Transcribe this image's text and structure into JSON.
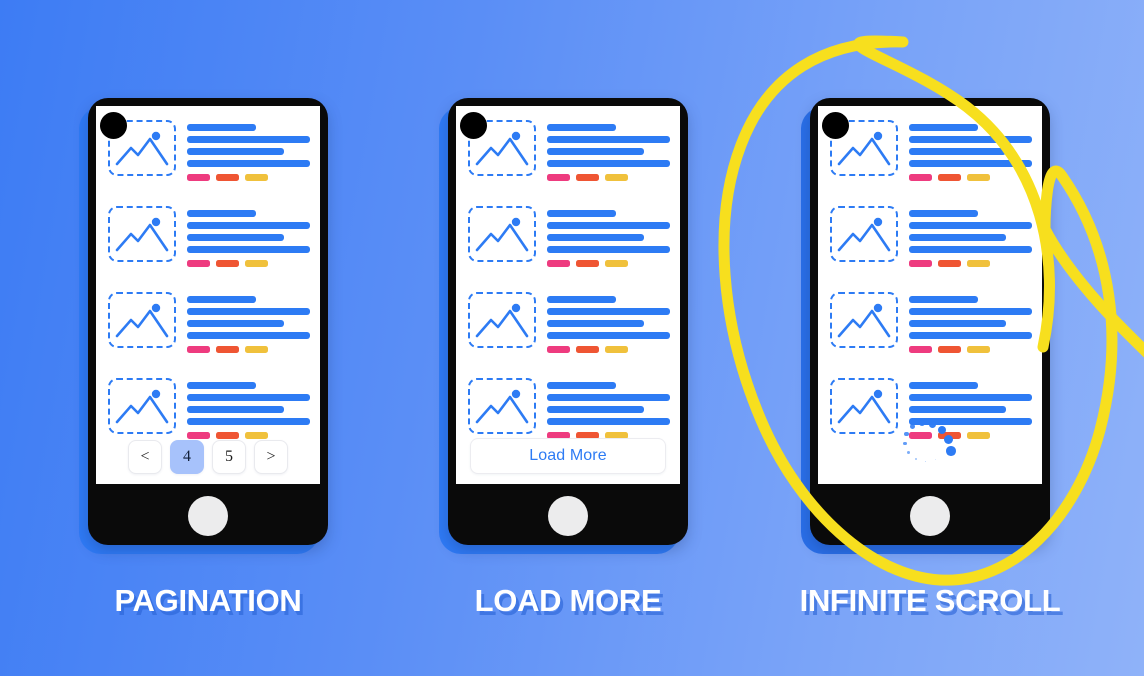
{
  "background": {
    "gradient_from": "#3d7cf4",
    "gradient_to": "#8fb2f9"
  },
  "theme": {
    "accent_blue": "#2d7bf4",
    "device_black": "#0a0a0a",
    "slab_blue": "#2f7af5",
    "chip_pink": "#ee3b7f",
    "chip_orange": "#ef5533",
    "chip_yellow": "#f0c13c",
    "active_page_bg": "#a7c2fb",
    "annotation_yellow": "#f7df1e",
    "home_button": "#ececed",
    "screen_white": "#ffffff"
  },
  "panels": [
    {
      "id": "pagination",
      "caption": "PAGINATION",
      "camera_icon": "camera-dot-icon",
      "feed_rows": [
        {
          "thumb_icon": "image-placeholder-icon",
          "lines": [
            "",
            "",
            "",
            ""
          ],
          "chips": [
            "#ee3b7f",
            "#ef5533",
            "#f0c13c"
          ]
        },
        {
          "thumb_icon": "image-placeholder-icon",
          "lines": [
            "",
            "",
            "",
            ""
          ],
          "chips": [
            "#ee3b7f",
            "#ef5533",
            "#f0c13c"
          ]
        },
        {
          "thumb_icon": "image-placeholder-icon",
          "lines": [
            "",
            "",
            "",
            ""
          ],
          "chips": [
            "#ee3b7f",
            "#ef5533",
            "#f0c13c"
          ]
        },
        {
          "thumb_icon": "image-placeholder-icon",
          "lines": [
            "",
            "",
            "",
            ""
          ],
          "chips": [
            "#ee3b7f",
            "#ef5533",
            "#f0c13c"
          ]
        }
      ],
      "control": {
        "type": "pagination",
        "buttons": [
          {
            "label": "<",
            "name": "prev-page-button",
            "active": false
          },
          {
            "label": "4",
            "name": "page-4-button",
            "active": true
          },
          {
            "label": "5",
            "name": "page-5-button",
            "active": false
          },
          {
            "label": ">",
            "name": "next-page-button",
            "active": false
          }
        ],
        "current_page": "4"
      }
    },
    {
      "id": "load-more",
      "caption": "LOAD MORE",
      "camera_icon": "camera-dot-icon",
      "feed_rows": [
        {
          "thumb_icon": "image-placeholder-icon",
          "lines": [
            "",
            "",
            "",
            ""
          ],
          "chips": [
            "#ee3b7f",
            "#ef5533",
            "#f0c13c"
          ]
        },
        {
          "thumb_icon": "image-placeholder-icon",
          "lines": [
            "",
            "",
            "",
            ""
          ],
          "chips": [
            "#ee3b7f",
            "#ef5533",
            "#f0c13c"
          ]
        },
        {
          "thumb_icon": "image-placeholder-icon",
          "lines": [
            "",
            "",
            "",
            ""
          ],
          "chips": [
            "#ee3b7f",
            "#ef5533",
            "#f0c13c"
          ]
        },
        {
          "thumb_icon": "image-placeholder-icon",
          "lines": [
            "",
            "",
            "",
            ""
          ],
          "chips": [
            "#ee3b7f",
            "#ef5533",
            "#f0c13c"
          ]
        }
      ],
      "control": {
        "type": "button",
        "label": "Load More"
      }
    },
    {
      "id": "infinite-scroll",
      "caption": "INFINITE SCROLL",
      "camera_icon": "camera-dot-icon",
      "feed_rows": [
        {
          "thumb_icon": "image-placeholder-icon",
          "lines": [
            "",
            "",
            "",
            ""
          ],
          "chips": [
            "#ee3b7f",
            "#ef5533",
            "#f0c13c"
          ]
        },
        {
          "thumb_icon": "image-placeholder-icon",
          "lines": [
            "",
            "",
            "",
            ""
          ],
          "chips": [
            "#ee3b7f",
            "#ef5533",
            "#f0c13c"
          ]
        },
        {
          "thumb_icon": "image-placeholder-icon",
          "lines": [
            "",
            "",
            "",
            ""
          ],
          "chips": [
            "#ee3b7f",
            "#ef5533",
            "#f0c13c"
          ]
        },
        {
          "thumb_icon": "image-placeholder-icon",
          "lines": [
            "",
            "",
            "",
            ""
          ],
          "chips": [
            "#ee3b7f",
            "#ef5533",
            "#f0c13c"
          ]
        }
      ],
      "control": {
        "type": "spinner",
        "label": "loading-spinner",
        "dot_count": 12
      },
      "highlighted": true,
      "annotation": "hand-drawn-yellow-circle"
    }
  ]
}
